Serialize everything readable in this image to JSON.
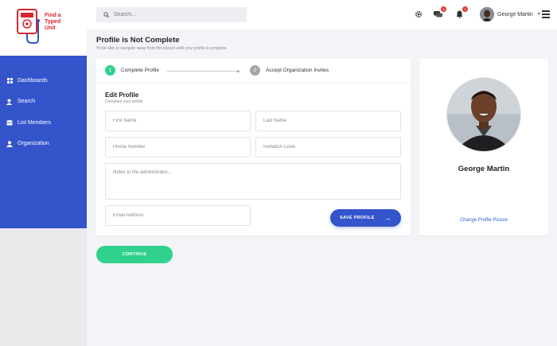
{
  "brand": {
    "logo_text": "Find a Typed Unit",
    "color": "#d8262f"
  },
  "sidebar": {
    "items": [
      {
        "label": "Dashboards",
        "icon": "grid-icon"
      },
      {
        "label": "Search",
        "icon": "user-search-icon"
      },
      {
        "label": "List Members",
        "icon": "group-icon"
      },
      {
        "label": "Organization",
        "icon": "person-icon"
      }
    ],
    "accent": "#3454cc"
  },
  "header": {
    "search_placeholder": "Search...",
    "messages_badge": "3",
    "notifications_badge": "2",
    "user_name": "George Martin"
  },
  "page": {
    "title": "Profile is Not Complete",
    "subtitle": "Yo be able to navigate away from this wizard untill your profile is complete."
  },
  "wizard": {
    "steps": [
      {
        "num": "1",
        "label": "Complete Profile",
        "status": "active",
        "color": "#2fd18c"
      },
      {
        "num": "2",
        "label": "Accept Organization Invites",
        "status": "pending",
        "color": "#a5a5a5"
      }
    ]
  },
  "form": {
    "title": "Edit Profile",
    "subtitle": "Complete your profile",
    "first_name_placeholder": "First Name",
    "last_name_placeholder": "Last Name",
    "phone_placeholder": "Phone Number",
    "invitation_placeholder": "Invitation Code",
    "notes_placeholder": "Notes to the administrator...",
    "email_placeholder": "Email Address",
    "save_label": "SAVE PROFILE"
  },
  "profile": {
    "name": "George Martin",
    "change_picture_label": "Change Profile Picture"
  },
  "continue_label": "CONTINUE"
}
